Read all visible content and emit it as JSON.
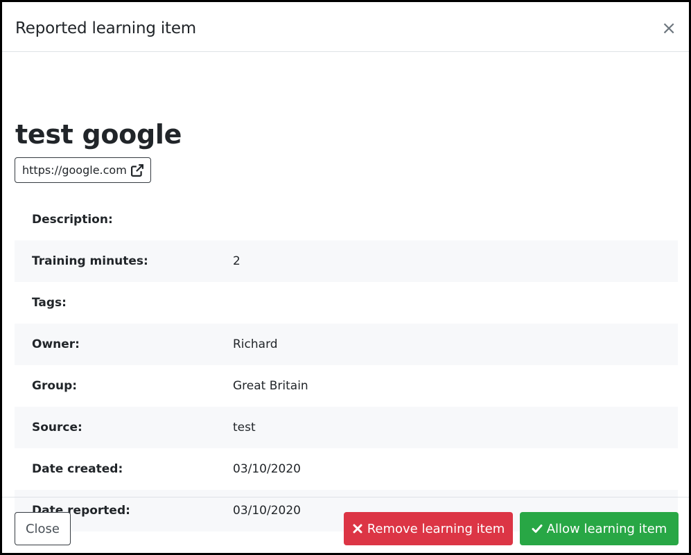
{
  "modal": {
    "title": "Reported learning item",
    "close_symbol": "×"
  },
  "item": {
    "title": "test google",
    "url": "https://google.com",
    "link_icon": "external-link-icon"
  },
  "details": [
    {
      "label": "Description:",
      "value": ""
    },
    {
      "label": "Training minutes:",
      "value": "2"
    },
    {
      "label": "Tags:",
      "value": ""
    },
    {
      "label": "Owner:",
      "value": "Richard"
    },
    {
      "label": "Group:",
      "value": "Great Britain"
    },
    {
      "label": "Source:",
      "value": "test"
    },
    {
      "label": "Date created:",
      "value": "03/10/2020"
    },
    {
      "label": "Date reported:",
      "value": "03/10/2020"
    }
  ],
  "footer": {
    "close_label": "Close",
    "remove_label": "Remove learning item",
    "remove_icon": "times-icon",
    "allow_label": "Allow learning item",
    "allow_icon": "check-icon"
  },
  "colors": {
    "danger": "#dc3545",
    "success": "#28a745",
    "row_stripe": "#f7f8fa"
  }
}
